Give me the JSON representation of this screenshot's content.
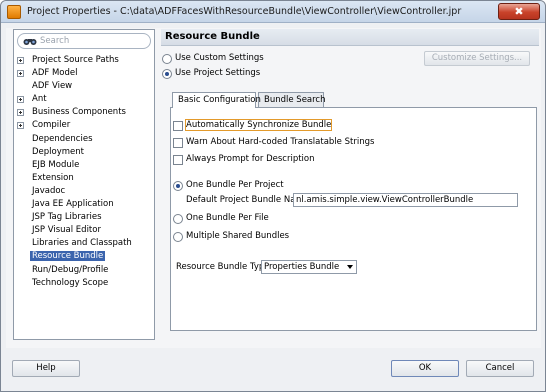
{
  "window": {
    "title": "Project Properties - C:\\data\\ADFFacesWithResourceBundle\\ViewController\\ViewController.jpr",
    "close_glyph": "✖"
  },
  "search": {
    "placeholder": "Search"
  },
  "tree": {
    "items": [
      {
        "label": "Project Source Paths",
        "expandable": true
      },
      {
        "label": "ADF Model",
        "expandable": true
      },
      {
        "label": "ADF View",
        "expandable": false
      },
      {
        "label": "Ant",
        "expandable": true
      },
      {
        "label": "Business Components",
        "expandable": true
      },
      {
        "label": "Compiler",
        "expandable": true
      },
      {
        "label": "Dependencies",
        "expandable": false
      },
      {
        "label": "Deployment",
        "expandable": false
      },
      {
        "label": "EJB Module",
        "expandable": false
      },
      {
        "label": "Extension",
        "expandable": false
      },
      {
        "label": "Javadoc",
        "expandable": false
      },
      {
        "label": "Java EE Application",
        "expandable": false
      },
      {
        "label": "JSP Tag Libraries",
        "expandable": false
      },
      {
        "label": "JSP Visual Editor",
        "expandable": false
      },
      {
        "label": "Libraries and Classpath",
        "expandable": false
      },
      {
        "label": "Resource Bundle",
        "expandable": false,
        "selected": true
      },
      {
        "label": "Run/Debug/Profile",
        "expandable": false
      },
      {
        "label": "Technology Scope",
        "expandable": false
      }
    ]
  },
  "panel": {
    "title": "Resource Bundle",
    "use_custom_settings": "Use Custom Settings",
    "use_project_settings": "Use Project Settings",
    "customize_button": "Customize Settings..."
  },
  "tabs": {
    "basic": "Basic Configuration",
    "bundle_search": "Bundle Search"
  },
  "basic": {
    "auto_sync": "Automatically Synchronize Bundle",
    "warn_hardcoded": "Warn About Hard-coded Translatable Strings",
    "always_prompt": "Always Prompt for Description",
    "one_bundle_per_project": "One Bundle Per Project",
    "default_bundle_label": "Default Project Bundle Name:",
    "default_bundle_value": "nl.amis.simple.view.ViewControllerBundle",
    "one_bundle_per_file": "One Bundle Per File",
    "multiple_shared": "Multiple Shared Bundles",
    "bundle_type_label": "Resource Bundle Type:",
    "bundle_type_value": "Properties Bundle"
  },
  "footer": {
    "help": "Help",
    "ok": "OK",
    "cancel": "Cancel"
  },
  "colors": {
    "selection": "#3b64ad",
    "focus_outline": "#e39a2b",
    "close_button": "#c9422a"
  }
}
